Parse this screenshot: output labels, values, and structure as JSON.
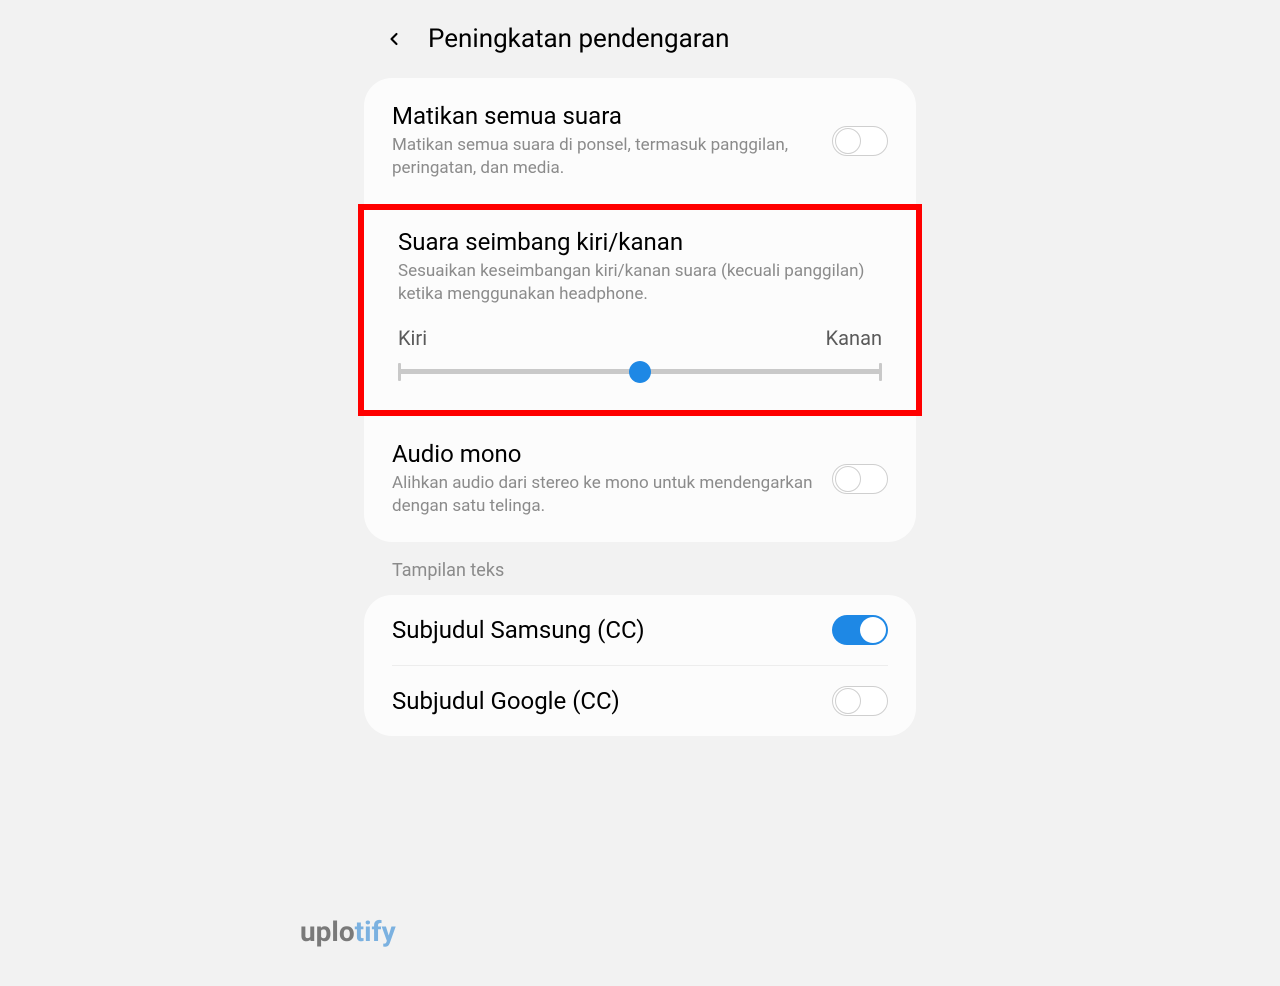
{
  "header": {
    "title": "Peningkatan pendengaran"
  },
  "mute_all": {
    "title": "Matikan semua suara",
    "desc": "Matikan semua suara di ponsel, termasuk panggilan, peringatan, dan media.",
    "enabled": false
  },
  "balance": {
    "title": "Suara seimbang kiri/kanan",
    "desc": "Sesuaikan keseimbangan kiri/kanan suara (kecuali panggilan) ketika menggunakan headphone.",
    "left_label": "Kiri",
    "right_label": "Kanan",
    "value": 50
  },
  "mono": {
    "title": "Audio mono",
    "desc": "Alihkan audio dari stereo ke mono untuk mendengarkan dengan satu telinga.",
    "enabled": false
  },
  "text_display": {
    "section": "Tampilan teks",
    "samsung": {
      "title": "Subjudul Samsung (CC)",
      "enabled": true
    },
    "google": {
      "title": "Subjudul Google (CC)",
      "enabled": false
    }
  },
  "watermark": {
    "part1": "uplo",
    "part2": "tify"
  }
}
